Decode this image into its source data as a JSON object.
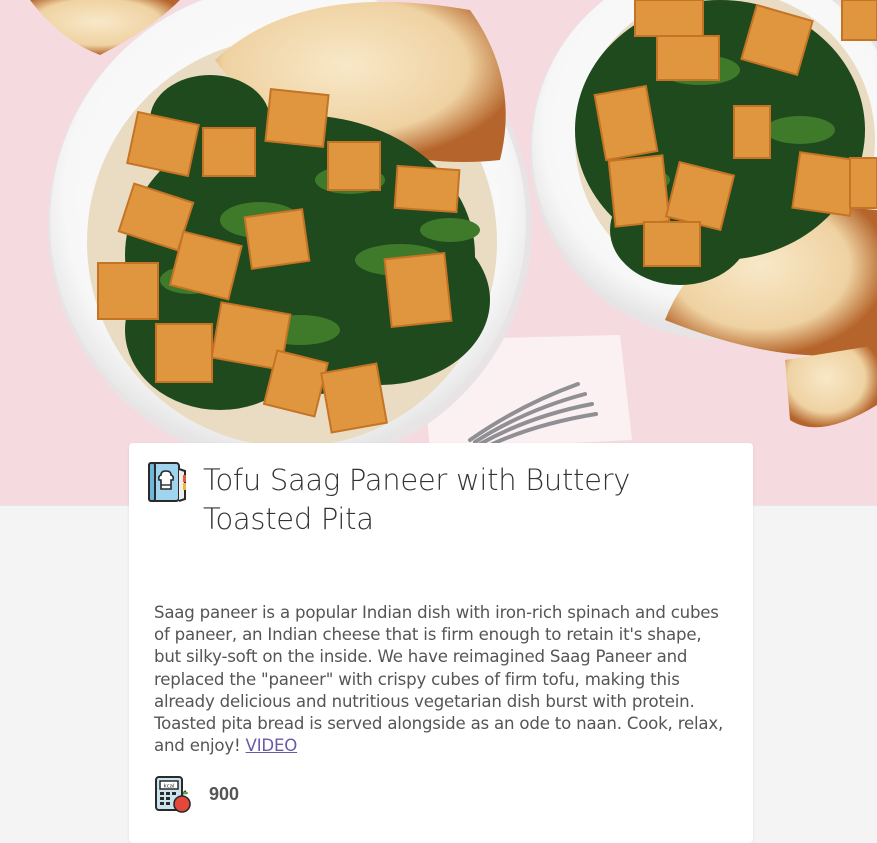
{
  "recipe": {
    "title": "Tofu Saag Paneer with Buttery Toasted Pita",
    "description": "Saag paneer is a popular Indian dish with iron-rich spinach and cubes of paneer, an Indian cheese that is firm enough to retain it's shape, but silky-soft on the inside. We have reimagined Saag Paneer and replaced the \"paneer\" with crispy cubes of firm tofu, making this already delicious and nutritious vegetarian dish burst with protein. Toasted pita bread is served alongside as an ode to naan. Cook, relax, and enjoy!",
    "video_link": "VIDEO",
    "calories": "900",
    "icons": {
      "title": "recipe-book-icon",
      "calories": "calorie-calculator-icon"
    }
  },
  "colors": {
    "background": "#f4f4f4",
    "card": "#ffffff",
    "title_text": "#333333",
    "body_text": "#555555",
    "link": "#6b5aa8",
    "hero_backdrop": "#f6dde1"
  }
}
